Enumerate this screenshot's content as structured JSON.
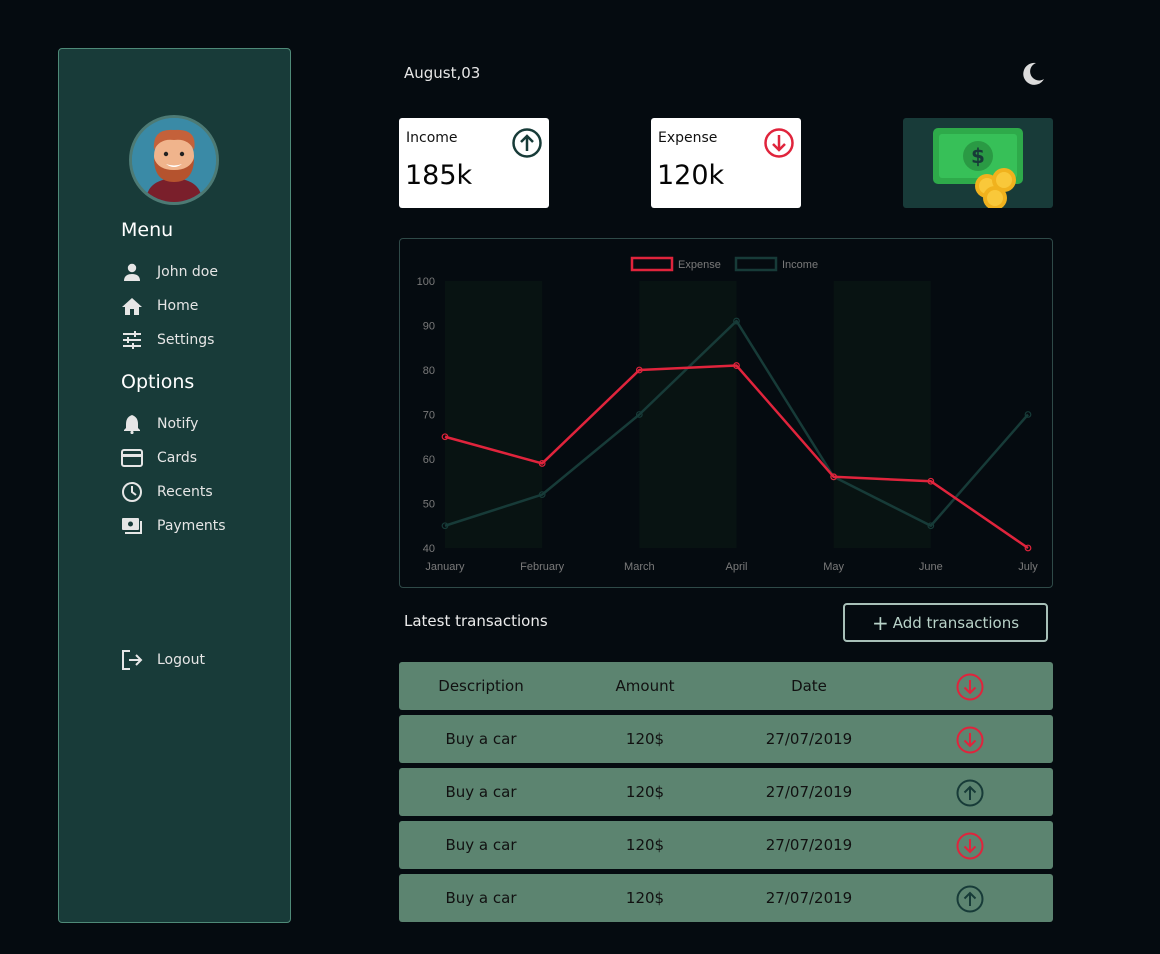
{
  "sidebar": {
    "menu_title": "Menu",
    "options_title": "Options",
    "menu_items": [
      {
        "label": "John doe",
        "icon": "user-icon"
      },
      {
        "label": "Home",
        "icon": "home-icon"
      },
      {
        "label": "Settings",
        "icon": "sliders-icon"
      }
    ],
    "option_items": [
      {
        "label": "Notify",
        "icon": "bell-icon"
      },
      {
        "label": "Cards",
        "icon": "credit-card-icon"
      },
      {
        "label": "Recents",
        "icon": "clock-icon"
      },
      {
        "label": "Payments",
        "icon": "payments-icon"
      }
    ],
    "logout_label": "Logout"
  },
  "header": {
    "date": "August,03"
  },
  "stats": {
    "income": {
      "label": "Income",
      "value": "185k"
    },
    "expense": {
      "label": "Expense",
      "value": "120k"
    }
  },
  "chart_data": {
    "type": "line",
    "categories": [
      "January",
      "February",
      "March",
      "April",
      "May",
      "June",
      "July"
    ],
    "series": [
      {
        "name": "Expense",
        "values": [
          65,
          59,
          80,
          81,
          56,
          55,
          40
        ],
        "color": "#e0243c"
      },
      {
        "name": "Income",
        "values": [
          45,
          52,
          70,
          91,
          56,
          45,
          70
        ],
        "color": "#173b38"
      }
    ],
    "ylim": [
      40,
      100
    ],
    "yticks": [
      40,
      50,
      60,
      70,
      80,
      90,
      100
    ],
    "legend": "top-center"
  },
  "transactions": {
    "title": "Latest transactions",
    "add_label": "Add transactions",
    "headers": {
      "description": "Description",
      "amount": "Amount",
      "date": "Date"
    },
    "rows": [
      {
        "description": "Buy a car",
        "amount": "120$",
        "date": "27/07/2019",
        "direction": "down"
      },
      {
        "description": "Buy a car",
        "amount": "120$",
        "date": "27/07/2019",
        "direction": "up"
      },
      {
        "description": "Buy a car",
        "amount": "120$",
        "date": "27/07/2019",
        "direction": "down"
      },
      {
        "description": "Buy a car",
        "amount": "120$",
        "date": "27/07/2019",
        "direction": "up"
      }
    ]
  },
  "colors": {
    "accent_red": "#e0243c",
    "accent_green": "#173b38",
    "row_bg": "#5c8470",
    "sidebar_bg": "#183b39"
  }
}
